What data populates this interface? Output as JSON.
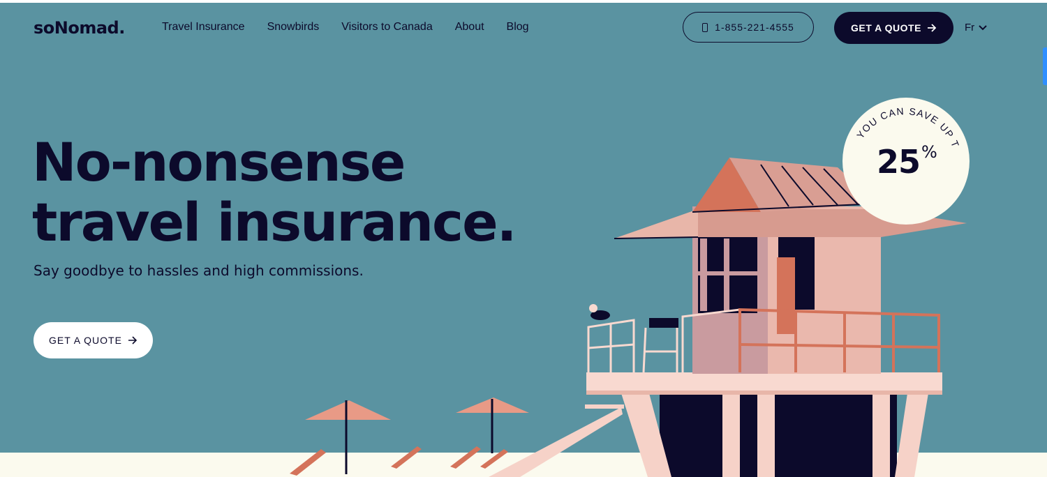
{
  "header": {
    "logo": "soNomad.",
    "nav": [
      "Travel Insurance",
      "Snowbirds",
      "Visitors to Canada",
      "About",
      "Blog"
    ],
    "phone": "1-855-221-4555",
    "quote_label": "GET A QUOTE",
    "lang": "Fr"
  },
  "hero": {
    "title_line1": "No-nonsense",
    "title_line2": "travel insurance.",
    "subtitle": "Say goodbye to hassles and high commissions.",
    "cta_label": "GET A QUOTE"
  },
  "badge": {
    "arc_text": "YOU CAN SAVE UP TO",
    "value": "25",
    "unit": "%"
  },
  "colors": {
    "background": "#5a93a1",
    "navy": "#0c0a2b",
    "cream": "#fbfaee",
    "pink": "#f0b9ad",
    "coral": "#d4735a"
  },
  "icons": [
    "phone-icon",
    "arrow-right-icon",
    "chevron-down-icon"
  ]
}
